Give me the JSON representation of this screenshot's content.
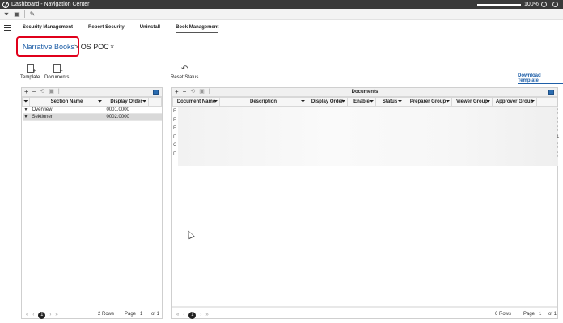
{
  "window": {
    "title": "Dashboard - Navigation Center",
    "zoom": "100%",
    "zoom_fraction": 1.0
  },
  "nav_tabs": [
    {
      "label": "Security Management"
    },
    {
      "label": "Report Security"
    },
    {
      "label": "Uninstall"
    },
    {
      "label": "Book Management",
      "active": true
    }
  ],
  "breadcrumb": {
    "link": "Narrative Books",
    "separator": ">",
    "current": "OS POC",
    "close": "×"
  },
  "actions": {
    "template": "Template",
    "documents": "Documents",
    "reset_status": "Reset Status",
    "download_template": "Download Template"
  },
  "left_grid": {
    "columns": [
      "Section Name",
      "Display Order"
    ],
    "rows": [
      {
        "expand": "▼",
        "name": "Overview",
        "order": "0001.0000"
      },
      {
        "expand": "▼",
        "name": "Sektioner",
        "order": "0002.0000",
        "selected": true
      }
    ],
    "pager": {
      "current": "1",
      "rows": "2 Rows",
      "page_label": "Page",
      "page": "1",
      "of": "of 1"
    }
  },
  "right_grid": {
    "title": "Documents",
    "columns": [
      "Document Name",
      "Description",
      "Display Order",
      "Enable",
      "Status",
      "Preparer Group",
      "Viewer Group",
      "Approver Group"
    ],
    "row_initials": [
      "F",
      "F",
      "F",
      "F",
      "C",
      "F"
    ],
    "row_tail": [
      "(",
      "(",
      "(",
      "1",
      "(",
      "("
    ],
    "pager": {
      "current": "1",
      "rows": "6 Rows",
      "page_label": "Page",
      "page": "1",
      "of": "of 1"
    }
  },
  "colors": {
    "accent_link": "#1f5fa8",
    "highlight_border": "#e0001b",
    "titlebar": "#3a3a3a"
  }
}
